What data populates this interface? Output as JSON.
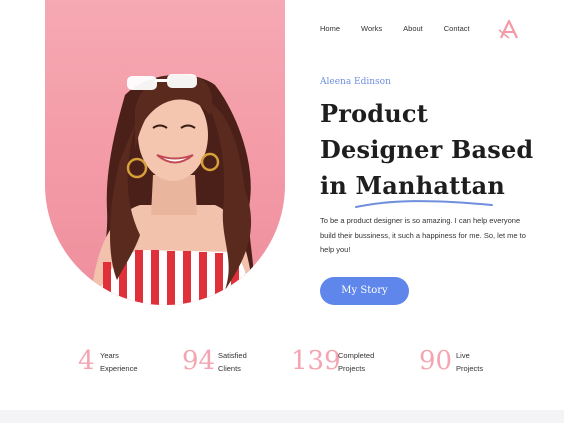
{
  "nav": {
    "items": [
      "Home",
      "Works",
      "About",
      "Contact"
    ]
  },
  "logo": {
    "icon": "a-monogram-logo-icon",
    "color": "#f39aa6"
  },
  "hero": {
    "author": "Aleena Edinson",
    "headline_line1": "Product",
    "headline_line2": "Designer Based",
    "headline_line3_prefix": "in",
    "headline_highlight": "Manhattan",
    "description": "To be a product designer is so amazing. I can help everyone build their bussiness, it such a happiness for me. So, let me to help you!",
    "cta_label": "My Story",
    "photo_icon": "smiling-woman-portrait-photo"
  },
  "stats": [
    {
      "number": "4",
      "label_line1": "Years",
      "label_line2": "Experience"
    },
    {
      "number": "94",
      "label_line1": "Satisfied",
      "label_line2": "Clients"
    },
    {
      "number": "139",
      "label_line1": "Completed",
      "label_line2": "Projects"
    },
    {
      "number": "90",
      "label_line1": "Live",
      "label_line2": "Projects"
    }
  ],
  "colors": {
    "accent_blue": "#5f86ea",
    "accent_pink": "#f3a6b2",
    "text_dark": "#1e1e1e"
  }
}
